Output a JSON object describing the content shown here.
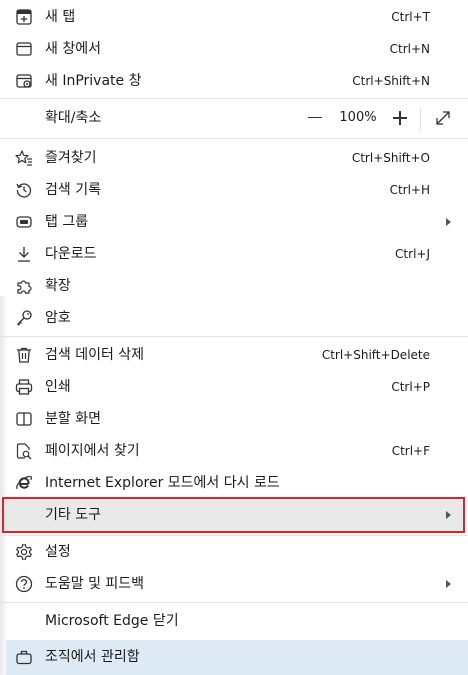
{
  "menu": {
    "new_tab": {
      "label": "새 탭",
      "shortcut": "Ctrl+T",
      "icon": "new-tab-icon"
    },
    "new_window": {
      "label": "새 창에서",
      "shortcut": "Ctrl+N",
      "icon": "new-window-icon"
    },
    "new_inprivate": {
      "label": "새 InPrivate 창",
      "shortcut": "Ctrl+Shift+N",
      "icon": "inprivate-icon"
    },
    "zoom": {
      "label": "확대/축소",
      "value": "100%",
      "minus": "minus-icon",
      "plus": "plus-icon",
      "fullscreen": "fullscreen-icon"
    },
    "favorites": {
      "label": "즐겨찾기",
      "shortcut": "Ctrl+Shift+O",
      "icon": "favorites-star-icon"
    },
    "history": {
      "label": "검색 기록",
      "shortcut": "Ctrl+H",
      "icon": "history-icon"
    },
    "tab_groups": {
      "label": "탭 그룹",
      "icon": "tab-groups-icon"
    },
    "downloads": {
      "label": "다운로드",
      "shortcut": "Ctrl+J",
      "icon": "download-icon"
    },
    "extensions": {
      "label": "확장",
      "icon": "puzzle-icon"
    },
    "passwords": {
      "label": "암호",
      "icon": "key-icon"
    },
    "clear_data": {
      "label": "검색 데이터 삭제",
      "shortcut": "Ctrl+Shift+Delete",
      "icon": "trash-icon"
    },
    "print": {
      "label": "인쇄",
      "shortcut": "Ctrl+P",
      "icon": "printer-icon"
    },
    "split_screen": {
      "label": "분할 화면",
      "icon": "split-screen-icon"
    },
    "find": {
      "label": "페이지에서 찾기",
      "shortcut": "Ctrl+F",
      "icon": "find-page-icon"
    },
    "ie_mode": {
      "label": "Internet Explorer 모드에서 다시 로드",
      "icon": "ie-icon"
    },
    "more_tools": {
      "label": "기타 도구"
    },
    "settings": {
      "label": "설정",
      "icon": "gear-icon"
    },
    "help": {
      "label": "도움말 및 피드백",
      "icon": "help-icon"
    },
    "close_edge": {
      "label": "Microsoft Edge 닫기"
    },
    "managed": {
      "label": "조직에서 관리함",
      "icon": "briefcase-icon"
    }
  },
  "colors": {
    "highlight_border": "#d9242c",
    "hover_background": "#e9e9e9",
    "managed_background": "#dde9f5",
    "divider": "#e3e3e3"
  }
}
